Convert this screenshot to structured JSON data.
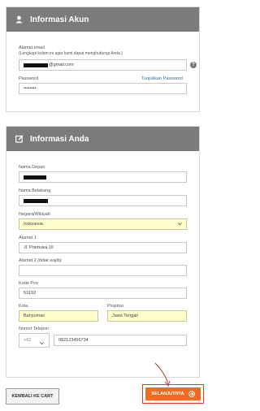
{
  "account": {
    "title": "Informasi Akun",
    "email_label": "Alamat email",
    "email_hint": "(Lengkapi kolom ini agar kami dapat menghubungi Anda.)",
    "email_suffix": "@gmail.com",
    "password_label": "Password",
    "password_value": "••••••••",
    "show_password": "Tunjukkan Password",
    "help_icon": "question-icon"
  },
  "personal": {
    "title": "Informasi Anda",
    "first_name_label": "Nama Depan",
    "last_name_label": "Nama Belakang",
    "country_label": "Negara/Wilayah",
    "country_value": "Indonesia",
    "address1_label": "Alamat 1",
    "address1_value": "Jl. Pramuka 10",
    "address2_label": "Alamat 2",
    "address2_optional": "(tidak wajib)",
    "postcode_label": "Kode Pos",
    "postcode_value": "53192",
    "city_label": "Kota",
    "city_value": "Banyumas",
    "province_label": "Propinsi",
    "province_value": "Jawa Tengah",
    "phone_label": "Nomor Telepon",
    "phone_code": "+62",
    "phone_value": "082123456734"
  },
  "buttons": {
    "back": "KEMBALI KE CART",
    "next": "SELANJUTNYA"
  },
  "colors": {
    "header": "#7b7b7b",
    "highlight": "#ffffcc",
    "next_button": "#f26b21",
    "annotation": "#e23a2a"
  }
}
